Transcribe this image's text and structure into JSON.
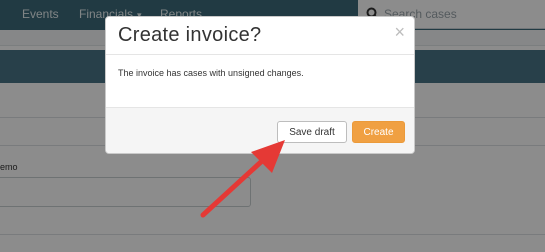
{
  "nav": {
    "items": [
      {
        "label": "Events"
      },
      {
        "label": "Financials"
      },
      {
        "label": "Reports"
      }
    ],
    "caret": "▾"
  },
  "search": {
    "placeholder": "Search cases"
  },
  "form": {
    "field_label": "emo"
  },
  "modal": {
    "title": "Create invoice?",
    "close_glyph": "×",
    "body": "The invoice has cases with unsigned changes.",
    "save_draft_label": "Save draft",
    "create_label": "Create"
  },
  "colors": {
    "nav_bg": "#3d6a7a",
    "banner_bg": "#4a7687",
    "primary_button": "#f0a042",
    "annotation_arrow": "#e53935"
  }
}
